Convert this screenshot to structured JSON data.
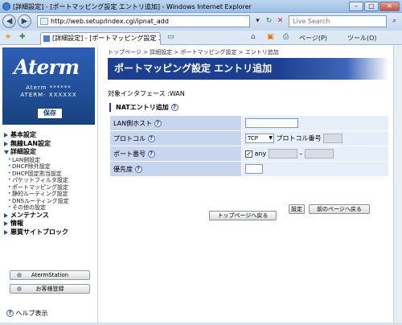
{
  "window": {
    "title": "[詳細設定] - [ポートマッピング設定 エントリ追加] - Windows Internet Explorer"
  },
  "addressbar": {
    "url": "http://web.setup/index.cgi/ipnat_add",
    "search_placeholder": "Live Search"
  },
  "tabbar": {
    "tab_title": "[詳細設定] - [ポートマッピング設定 エントリ...",
    "page_label": "ページ(P)",
    "tools_label": "ツール(O)"
  },
  "sidebar": {
    "logo": "Aterm",
    "model_line1": "Aterm ******",
    "model_line2": "ATERM- XXXXXX",
    "save_label": "保存",
    "menu": [
      {
        "label": "基本設定",
        "open": false,
        "items": []
      },
      {
        "label": "無線LAN設定",
        "open": false,
        "items": []
      },
      {
        "label": "詳細設定",
        "open": true,
        "items": [
          "LAN側設定",
          "DHCP除外設定",
          "DHCP固定割当設定",
          "パケットフィルタ設定",
          "ポートマッピング設定",
          "静的ルーティング設定",
          "DNSルーティング設定",
          "その他の設定"
        ]
      },
      {
        "label": "メンテナンス",
        "open": false,
        "items": []
      },
      {
        "label": "情報",
        "open": false,
        "items": []
      },
      {
        "label": "悪質サイトブロック",
        "open": false,
        "items": []
      }
    ],
    "aterm_station_label": "AtermStation",
    "register_label": "お客様登録",
    "help_label": "ヘルプ表示"
  },
  "main": {
    "breadcrumb": "トップページ > 詳細設定 > ポートマッピング設定 > エントリ追加",
    "title": "ポートマッピング設定 エントリ追加",
    "interface_label": "対象インタフェース :WAN",
    "section_title": "NATエントリ追加",
    "rows": {
      "lan_host_label": "LAN側ホスト",
      "lan_host_value": "",
      "protocol_label": "プロトコル",
      "protocol_value": "TCP",
      "protocol_number_label": "プロトコル番号",
      "port_label": "ポート番号",
      "port_any_label": "any",
      "port_separator": "–",
      "priority_label": "優先度",
      "priority_value": ""
    },
    "set_button": "設定",
    "back_button": "前のページへ戻る",
    "top_button": "トップページへ戻る"
  }
}
